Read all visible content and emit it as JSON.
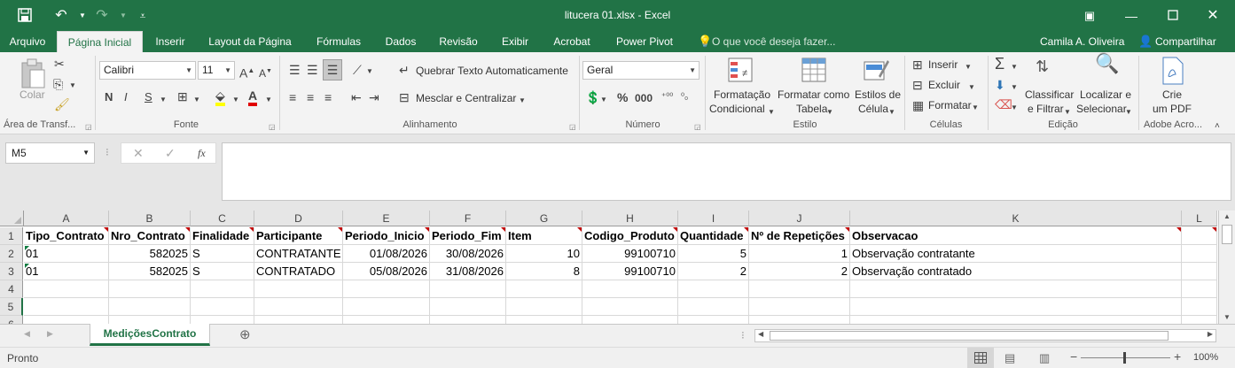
{
  "title": "litucera 01.xlsx - Excel",
  "tabs": [
    "Arquivo",
    "Página Inicial",
    "Inserir",
    "Layout da Página",
    "Fórmulas",
    "Dados",
    "Revisão",
    "Exibir",
    "Acrobat",
    "Power Pivot"
  ],
  "tell_me": "O que você deseja fazer...",
  "user": "Camila A. Oliveira",
  "share": "Compartilhar",
  "ribbon": {
    "clipboard": {
      "paste": "Colar",
      "label": "Área de Transf..."
    },
    "font": {
      "name": "Calibri",
      "size": "11",
      "bold": "N",
      "italic": "I",
      "underline": "S",
      "label": "Fonte"
    },
    "alignment": {
      "wrap": "Quebrar Texto Automaticamente",
      "merge": "Mesclar e Centralizar",
      "label": "Alinhamento"
    },
    "number": {
      "format": "Geral",
      "label": "Número"
    },
    "styles": {
      "cond1": "Formatação",
      "cond2": "Condicional",
      "table1": "Formatar como",
      "table2": "Tabela",
      "cell1": "Estilos de",
      "cell2": "Célula",
      "label": "Estilo"
    },
    "cells": {
      "insert": "Inserir",
      "delete": "Excluir",
      "format": "Formatar",
      "label": "Células"
    },
    "editing": {
      "sort1": "Classificar",
      "sort2": "e Filtrar",
      "find1": "Localizar e",
      "find2": "Selecionar",
      "label": "Edição"
    },
    "acrobat": {
      "pdf1": "Crie",
      "pdf2": "um PDF",
      "label": "Adobe Acro..."
    }
  },
  "name_box": "M5",
  "formula_fx": "fx",
  "columns": [
    "A",
    "B",
    "C",
    "D",
    "E",
    "F",
    "G",
    "H",
    "I",
    "J",
    "K",
    "L"
  ],
  "rows": [
    "1",
    "2",
    "3",
    "4",
    "5",
    "6"
  ],
  "headers": [
    "Tipo_Contrato",
    "Nro_Contrato",
    "Finalidade",
    "Participante",
    "Periodo_Inicio",
    "Periodo_Fim",
    "Item",
    "Codigo_Produto",
    "Quantidade",
    "Nº de Repetições",
    "Observacao"
  ],
  "data": [
    [
      "01",
      "582025",
      "S",
      "CONTRATANTE",
      "01/08/2026",
      "30/08/2026",
      "10",
      "99100710",
      "5",
      "1",
      "Observação contratante"
    ],
    [
      "01",
      "582025",
      "S",
      "CONTRATADO",
      "05/08/2026",
      "31/08/2026",
      "8",
      "99100710",
      "2",
      "2",
      "Observação contratado"
    ]
  ],
  "sheet_tab": "MediçõesContrato",
  "status": "Pronto",
  "zoom": "100%"
}
